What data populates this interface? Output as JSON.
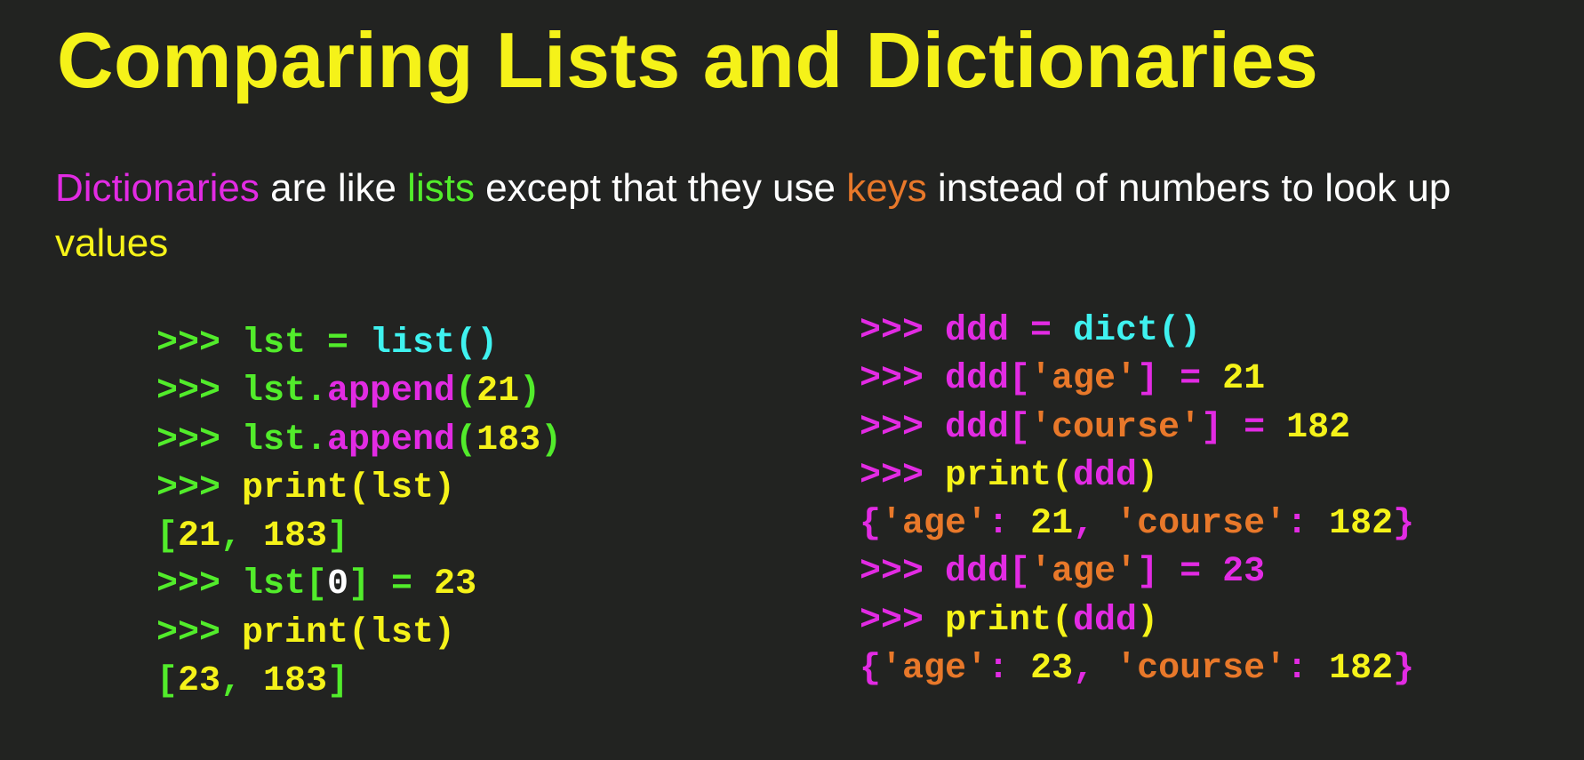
{
  "title": "Comparing Lists and Dictionaries",
  "colors": {
    "background": "#222321",
    "title": "#f5f219",
    "text": "#ffffff",
    "green": "#52ec2b",
    "cyan": "#3ff2f0",
    "magenta": "#e22be3",
    "yellow": "#f5f219",
    "orange": "#e8782a"
  },
  "description": {
    "segments": [
      {
        "text": "Dictionaries",
        "color": "magenta"
      },
      {
        "text": " are like ",
        "color": "text"
      },
      {
        "text": "lists",
        "color": "green"
      },
      {
        "text": " except that they use ",
        "color": "text"
      },
      {
        "text": "keys",
        "color": "orange"
      },
      {
        "text": " instead of numbers to look up ",
        "color": "text"
      },
      {
        "text": "values",
        "color": "yellow"
      }
    ]
  },
  "code_left": {
    "lines": [
      [
        {
          "t": ">>> ",
          "c": "green"
        },
        {
          "t": "lst",
          "c": "green"
        },
        {
          "t": " = ",
          "c": "green"
        },
        {
          "t": "list()",
          "c": "cyan"
        }
      ],
      [
        {
          "t": ">>> ",
          "c": "green"
        },
        {
          "t": "lst.",
          "c": "green"
        },
        {
          "t": "append",
          "c": "magenta"
        },
        {
          "t": "(",
          "c": "green"
        },
        {
          "t": "21",
          "c": "yellow"
        },
        {
          "t": ")",
          "c": "green"
        }
      ],
      [
        {
          "t": ">>> ",
          "c": "green"
        },
        {
          "t": "lst.",
          "c": "green"
        },
        {
          "t": "append",
          "c": "magenta"
        },
        {
          "t": "(",
          "c": "green"
        },
        {
          "t": "183",
          "c": "yellow"
        },
        {
          "t": ")",
          "c": "green"
        }
      ],
      [
        {
          "t": ">>> ",
          "c": "green"
        },
        {
          "t": "print(lst)",
          "c": "yellow"
        }
      ],
      [
        {
          "t": "[",
          "c": "green"
        },
        {
          "t": "21",
          "c": "yellow"
        },
        {
          "t": ", ",
          "c": "green"
        },
        {
          "t": "183",
          "c": "yellow"
        },
        {
          "t": "]",
          "c": "green"
        }
      ],
      [
        {
          "t": ">>> ",
          "c": "green"
        },
        {
          "t": "lst[",
          "c": "green"
        },
        {
          "t": "0",
          "c": "text"
        },
        {
          "t": "] = ",
          "c": "green"
        },
        {
          "t": "23",
          "c": "yellow"
        }
      ],
      [
        {
          "t": ">>> ",
          "c": "green"
        },
        {
          "t": "print(lst)",
          "c": "yellow"
        }
      ],
      [
        {
          "t": "[",
          "c": "green"
        },
        {
          "t": "23",
          "c": "yellow"
        },
        {
          "t": ", ",
          "c": "green"
        },
        {
          "t": "183",
          "c": "yellow"
        },
        {
          "t": "]",
          "c": "green"
        }
      ]
    ]
  },
  "code_right": {
    "lines": [
      [
        {
          "t": ">>> ",
          "c": "magenta"
        },
        {
          "t": "ddd",
          "c": "magenta"
        },
        {
          "t": " = ",
          "c": "magenta"
        },
        {
          "t": "dict()",
          "c": "cyan"
        }
      ],
      [
        {
          "t": ">>> ",
          "c": "magenta"
        },
        {
          "t": "ddd[",
          "c": "magenta"
        },
        {
          "t": "'age'",
          "c": "orange"
        },
        {
          "t": "] = ",
          "c": "magenta"
        },
        {
          "t": "21",
          "c": "yellow"
        }
      ],
      [
        {
          "t": ">>> ",
          "c": "magenta"
        },
        {
          "t": "ddd[",
          "c": "magenta"
        },
        {
          "t": "'course'",
          "c": "orange"
        },
        {
          "t": "] = ",
          "c": "magenta"
        },
        {
          "t": "182",
          "c": "yellow"
        }
      ],
      [
        {
          "t": ">>> ",
          "c": "magenta"
        },
        {
          "t": "print(",
          "c": "yellow"
        },
        {
          "t": "ddd",
          "c": "magenta"
        },
        {
          "t": ")",
          "c": "yellow"
        }
      ],
      [
        {
          "t": "{",
          "c": "magenta"
        },
        {
          "t": "'age'",
          "c": "orange"
        },
        {
          "t": ": ",
          "c": "magenta"
        },
        {
          "t": "21",
          "c": "yellow"
        },
        {
          "t": ", ",
          "c": "magenta"
        },
        {
          "t": "'course'",
          "c": "orange"
        },
        {
          "t": ": ",
          "c": "magenta"
        },
        {
          "t": "182",
          "c": "yellow"
        },
        {
          "t": "}",
          "c": "magenta"
        }
      ],
      [
        {
          "t": ">>> ",
          "c": "magenta"
        },
        {
          "t": "ddd[",
          "c": "magenta"
        },
        {
          "t": "'age'",
          "c": "orange"
        },
        {
          "t": "] = ",
          "c": "magenta"
        },
        {
          "t": "23",
          "c": "magenta"
        }
      ],
      [
        {
          "t": ">>> ",
          "c": "magenta"
        },
        {
          "t": "print(",
          "c": "yellow"
        },
        {
          "t": "ddd",
          "c": "magenta"
        },
        {
          "t": ")",
          "c": "yellow"
        }
      ],
      [
        {
          "t": "{",
          "c": "magenta"
        },
        {
          "t": "'age'",
          "c": "orange"
        },
        {
          "t": ": ",
          "c": "magenta"
        },
        {
          "t": "23",
          "c": "yellow"
        },
        {
          "t": ", ",
          "c": "magenta"
        },
        {
          "t": "'course'",
          "c": "orange"
        },
        {
          "t": ": ",
          "c": "magenta"
        },
        {
          "t": "182",
          "c": "yellow"
        },
        {
          "t": "}",
          "c": "magenta"
        }
      ]
    ]
  }
}
